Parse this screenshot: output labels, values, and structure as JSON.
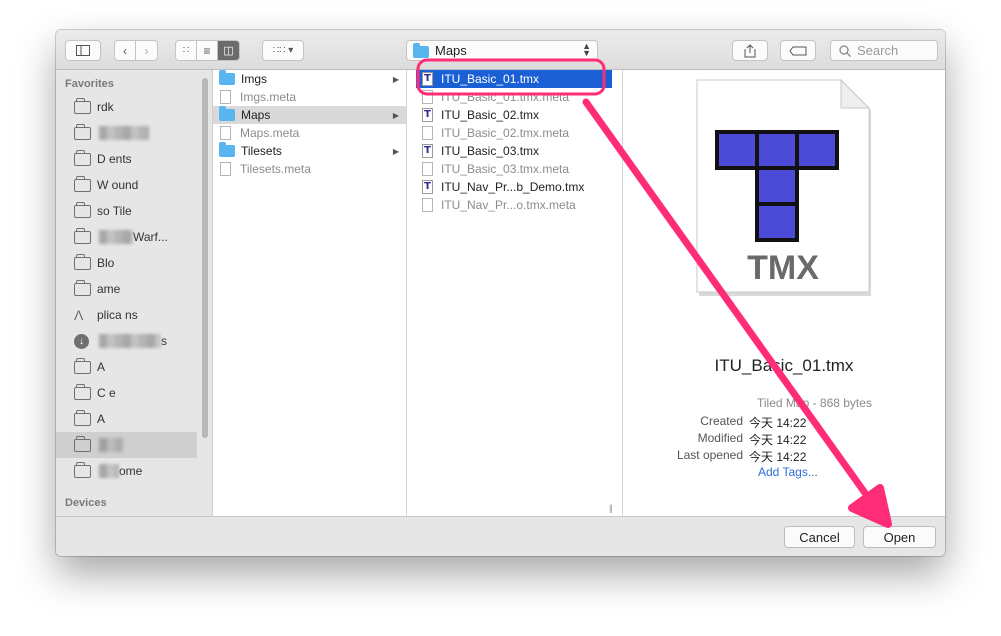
{
  "toolbar": {
    "path_folder": "Maps",
    "search_placeholder": "Search"
  },
  "sidebar": {
    "favorites_header": "Favorites",
    "devices_header": "Devices",
    "items": [
      {
        "label": "rdk"
      },
      {
        "label": ""
      },
      {
        "label": "D  ents"
      },
      {
        "label": "W  ound"
      },
      {
        "label": "so  Tile"
      },
      {
        "label": "Warf..."
      },
      {
        "label": "Blo"
      },
      {
        "label": "ame"
      },
      {
        "label": "plica  ns"
      },
      {
        "label": "s"
      },
      {
        "label": "A"
      },
      {
        "label": "C  e"
      },
      {
        "label": "A"
      },
      {
        "label": ""
      },
      {
        "label": "ome"
      }
    ]
  },
  "column1": {
    "items": [
      {
        "label": "Imgs",
        "kind": "folder",
        "has_children": true
      },
      {
        "label": "Imgs.meta",
        "kind": "doc"
      },
      {
        "label": "Maps",
        "kind": "folder",
        "has_children": true,
        "selected": true
      },
      {
        "label": "Maps.meta",
        "kind": "doc"
      },
      {
        "label": "Tilesets",
        "kind": "folder",
        "has_children": true
      },
      {
        "label": "Tilesets.meta",
        "kind": "doc"
      }
    ]
  },
  "column2": {
    "items": [
      {
        "label": "ITU_Basic_01.tmx",
        "kind": "tmx",
        "selected": true
      },
      {
        "label": "ITU_Basic_01.tmx.meta",
        "kind": "doc"
      },
      {
        "label": "ITU_Basic_02.tmx",
        "kind": "tmx"
      },
      {
        "label": "ITU_Basic_02.tmx.meta",
        "kind": "doc"
      },
      {
        "label": "ITU_Basic_03.tmx",
        "kind": "tmx"
      },
      {
        "label": "ITU_Basic_03.tmx.meta",
        "kind": "doc"
      },
      {
        "label": "ITU_Nav_Pr...b_Demo.tmx",
        "kind": "tmx"
      },
      {
        "label": "ITU_Nav_Pr...o.tmx.meta",
        "kind": "doc"
      }
    ]
  },
  "preview": {
    "icon_text": "TMX",
    "filename": "ITU_Basic_01.tmx",
    "kind": "Tiled Map - 868 bytes",
    "created_label": "Created",
    "created_value": "今天 14:22",
    "modified_label": "Modified",
    "modified_value": "今天 14:22",
    "opened_label": "Last opened",
    "opened_value": "今天 14:22",
    "add_tags": "Add Tags..."
  },
  "buttons": {
    "cancel": "Cancel",
    "open": "Open"
  },
  "annotation": {
    "color": "#ff2d78"
  },
  "colors": {
    "selection_blue": "#1b5fd4",
    "folder_blue": "#58b5f0",
    "tmx_icon_fill": "#4b4bd8"
  }
}
